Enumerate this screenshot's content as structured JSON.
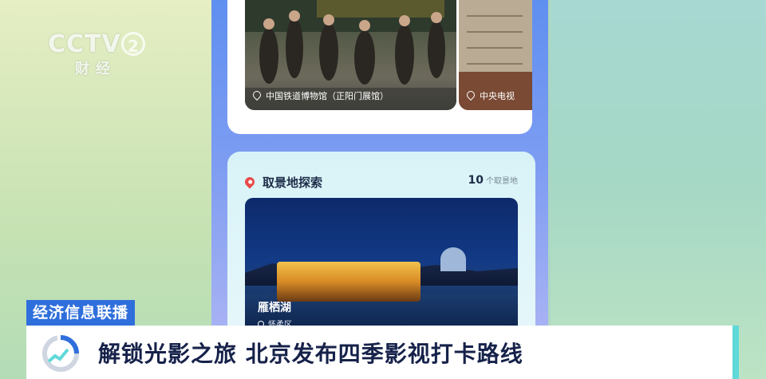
{
  "channel_logo": {
    "main": "CCTV",
    "number": "2",
    "sub": "财经"
  },
  "app": {
    "top_photos": [
      {
        "caption": "中国铁道博物馆（正阳门展馆）"
      },
      {
        "caption": "中央电视"
      }
    ],
    "section": {
      "title": "取景地探索",
      "count": "10",
      "count_unit": "个取景地",
      "featured": {
        "name": "雁栖湖",
        "location": "怀柔区"
      }
    }
  },
  "lower_third": {
    "program": "经济信息联播",
    "headline": "解锁光影之旅 北京发布四季影视打卡路线"
  },
  "colors": {
    "program_tag": "#2f6fdc",
    "accent": "#5fd9d9",
    "pin": "#e84a4a"
  }
}
